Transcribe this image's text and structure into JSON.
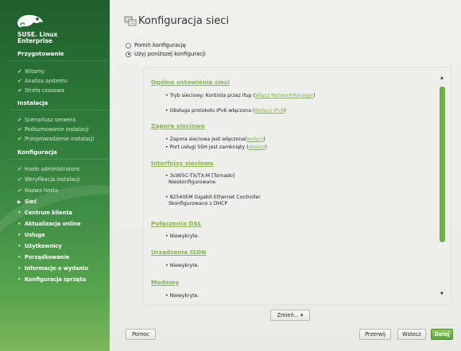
{
  "sidebar": {
    "brand_line1": "SUSE. Linux",
    "brand_line2": "Enterprise",
    "section_prep": "Przygotowanie",
    "prep_items": [
      "Witamy",
      "Analiza systemu",
      "Strefa czasowa"
    ],
    "section_install": "Instalacja",
    "install_items": [
      "Scenariusz serwera",
      "Podsumowanie instalacji",
      "Przeprowadzenie instalacji"
    ],
    "section_config": "Konfiguracja",
    "config_done": [
      "Hasło administratora",
      "Weryfikacja instalacji",
      "Nazwa hosta"
    ],
    "config_active": "Sieć",
    "config_pending": [
      "Centrum klienta",
      "Aktualizacja online",
      "Usługa",
      "Użytkownicy",
      "Porządkowanie",
      "Informacje o wydaniu",
      "Konfiguracja sprzętu"
    ]
  },
  "header": {
    "title": "Konfiguracja sieci"
  },
  "options": {
    "skip": "Pomiń konfigurację",
    "use": "Użyj poniższej konfiguracji"
  },
  "summary": {
    "general_h": "Ogólne ustawienia sieci",
    "mode_text": "Tryb sieciowy: Kontrola przez ifup (",
    "mode_link": "Włącz NetworkManager",
    "mode_close": ")",
    "ipv6_text": "Obsługa protokołu IPv6 włączona (",
    "ipv6_link": "Wyłącz IPv6",
    "ipv6_close": ")",
    "firewall_h": "Zapora sieciowa",
    "fw_text": "Zapora sieciowa jest włączona(",
    "fw_link": "wyłącz",
    "fw_close": ")",
    "ssh_text": "Port usługi SSH jest zamknięty (",
    "ssh_link": "otwórz",
    "ssh_close": ")",
    "ifaces_h": "Interfejsy sieciowe",
    "if1_name": "3c905C-TX/TX-M [Tornado]",
    "if1_status": "Nieskonfigurowane.",
    "if2_name": "82540EM Gigabit Ethernet Controller",
    "if2_status": "Skonfigurowano z DHCP",
    "dsl_h": "Połączenia DSL",
    "dsl_val": "Niewykryte.",
    "isdn_h": "Urządzenia ISDN",
    "isdn_val": "Niewykryte.",
    "modem_h": "Modemy",
    "modem_val": "Niewykryte."
  },
  "buttons": {
    "change": "Zmień...",
    "help": "Pomoc",
    "abort": "Przerwij",
    "back": "Wstecz",
    "next": "Dalej"
  },
  "colors": {
    "accent": "#86b54a",
    "sidebar": "#2f7a3a",
    "thumb": "#6ab43f"
  }
}
